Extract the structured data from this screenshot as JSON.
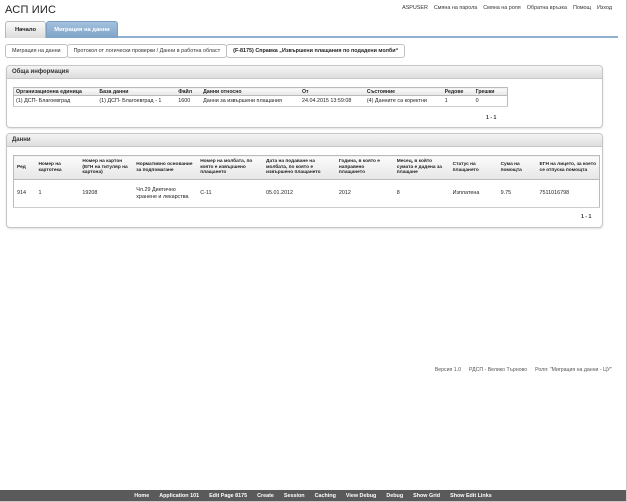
{
  "app": {
    "title": "АСП ИИС",
    "top_links": [
      "ASPUSER",
      "Смяна на парола",
      "Смяна на роля",
      "Обратна връзка",
      "Помощ",
      "Изход"
    ]
  },
  "tabs": [
    {
      "label": "Начало",
      "active": false
    },
    {
      "label": "Миграция на данни",
      "active": true
    }
  ],
  "breadcrumb": [
    "Миграция на данни",
    "Протокол от логически проверки / Данни в работна област",
    "(F-8175) Справка „Извършени плащания по подадени молби“"
  ],
  "general": {
    "title": "Обща информация",
    "columns": [
      "Организационна единица",
      "База данни",
      "Файл",
      "Данни относно",
      "От",
      "Състояние",
      "Редове",
      "Грешки"
    ],
    "rows": [
      [
        "(1) ДСП- Благоевград",
        "(1) ДСП- Благоевград - 1",
        "1600",
        "Данни за извършени плащания",
        "24.04.2015 13:59:08",
        "(4) Данните са коректни",
        "1",
        "0"
      ]
    ],
    "pagination": "1 - 1"
  },
  "data_region": {
    "title": "Данни",
    "columns": [
      "Ред",
      "Номер на картотека",
      "Номер на картон (ЕГН на титуляр на картона)",
      "Нормативно основание за подпомагане",
      "Номер на молбата, по която е извършено плащането",
      "Дата на подаване на молбата, по която е извършено плащането",
      "Година, в която е направено плащането",
      "Месец, в който сумата е дадена за плащане",
      "Статус на плащането",
      "Сума на помощта",
      "ЕГН на лицето, за което се отпуска помощта"
    ],
    "rows": [
      [
        "914",
        "1",
        "19208",
        "Чл.29 Диетично хранене и лекарства",
        "С-11",
        "05.01.2012",
        "2012",
        "8",
        "Изплатена",
        "9.75",
        "7511016798"
      ]
    ],
    "pagination": "1 - 1"
  },
  "footer": {
    "version": "Версия 1.0",
    "unit": "РДСП - Велико Търново",
    "role": "Роля: \"Миграция на данни - ЦУ\""
  },
  "dev_toolbar": [
    "Home",
    "Application 101",
    "Edit Page 8175",
    "Create",
    "Session",
    "Caching",
    "View Debug",
    "Debug",
    "Show Grid",
    "Show Edit Links"
  ]
}
